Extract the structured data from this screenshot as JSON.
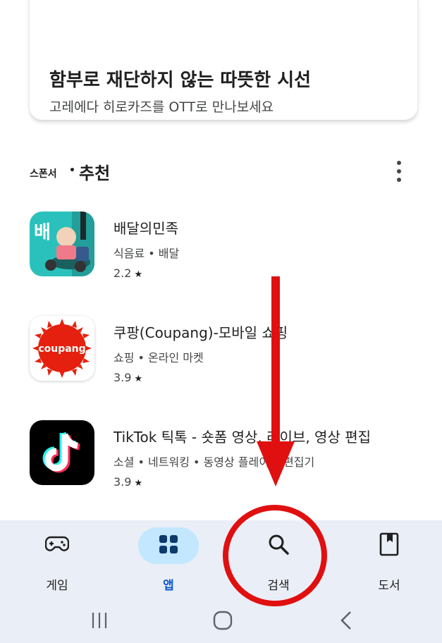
{
  "promo": {
    "title": "함부로 재단하지 않는 따뜻한 시선",
    "subtitle": "고레에다 히로카즈를 OTT로 만나보세요"
  },
  "section": {
    "sponsor_label": "스폰서",
    "separator": "•",
    "title": "추천"
  },
  "apps": [
    {
      "name": "배달의민족",
      "category": "식음료 • 배달",
      "rating": "2.2",
      "icon_text": "배"
    },
    {
      "name": "쿠팡(Coupang)-모바일 쇼핑",
      "category": "쇼핑 • 온라인 마켓",
      "rating": "3.9",
      "icon_text": "coupang"
    },
    {
      "name": "TikTok 틱톡 - 숏폼 영상, 라이브, 영상 편집",
      "category": "소셜 • 네트워킹 • 동영상 플레이어/편집기",
      "rating": "3.9",
      "icon_text": ""
    }
  ],
  "bottom_nav": {
    "items": [
      {
        "label": "게임",
        "icon": "gamepad-icon",
        "active": false
      },
      {
        "label": "앱",
        "icon": "apps-grid-icon",
        "active": true
      },
      {
        "label": "검색",
        "icon": "search-icon",
        "active": false
      },
      {
        "label": "도서",
        "icon": "book-icon",
        "active": false
      }
    ]
  },
  "system_nav": {
    "icons": [
      "recents-icon",
      "home-icon",
      "back-icon"
    ]
  },
  "colors": {
    "annotation_red": "#e01010",
    "nav_bg": "#eaeef6",
    "active_pill": "#c2e7ff",
    "baemin_teal": "#2ac1bc",
    "coupang_red": "#e5200e"
  }
}
